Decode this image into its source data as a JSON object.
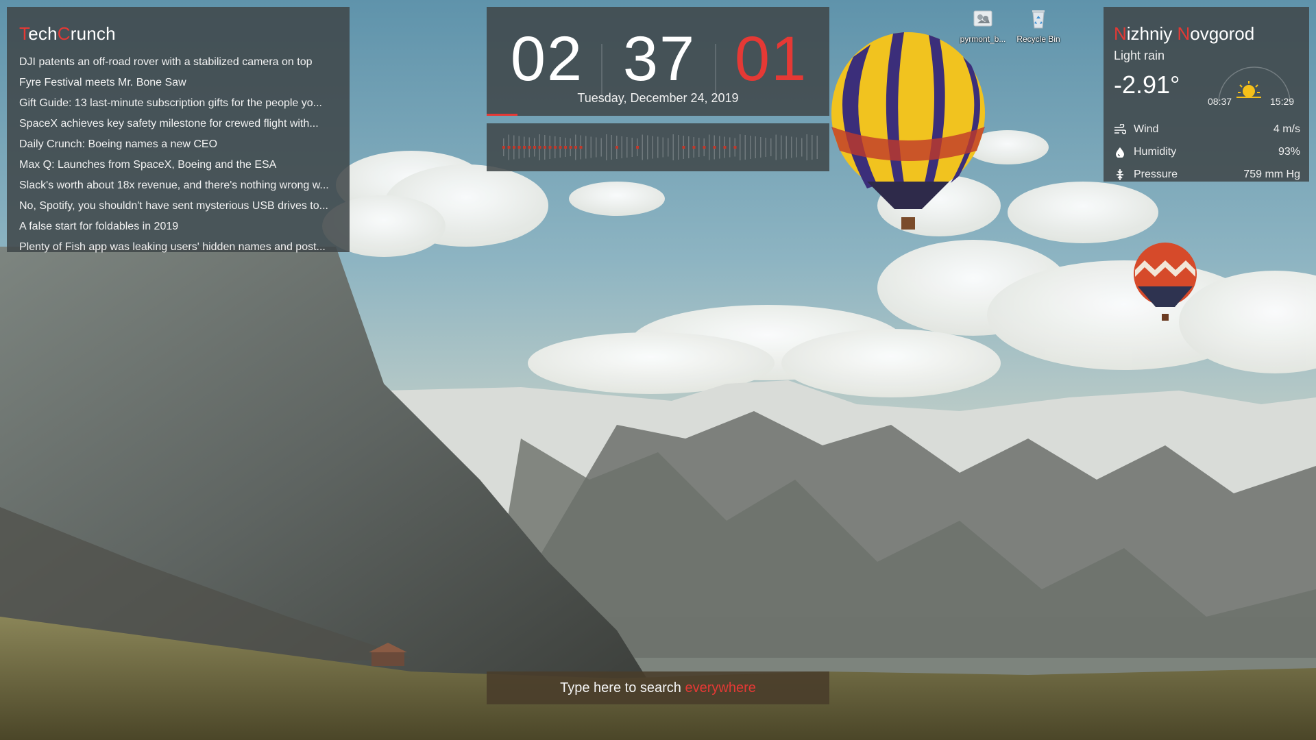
{
  "news": {
    "title_first": "T",
    "title_mid": "ech",
    "title_accent": "C",
    "title_rest": "runch",
    "items": [
      "DJI patents an off-road rover with a stabilized camera on top",
      "Fyre Festival meets Mr. Bone Saw",
      "Gift Guide: 13 last-minute subscription gifts for the people yo...",
      "SpaceX achieves key safety milestone for crewed flight with...",
      "Daily Crunch: Boeing names a new CEO",
      "Max Q: Launches from SpaceX, Boeing and the ESA",
      "Slack's worth about 18x revenue, and there's nothing wrong w...",
      "No, Spotify, you shouldn't have sent mysterious USB drives to...",
      "A false start for foldables in 2019",
      "Plenty of Fish app was leaking users' hidden names and post..."
    ]
  },
  "clock": {
    "hours": "02",
    "minutes": "37",
    "seconds": "01",
    "date": "Tuesday, December 24, 2019",
    "seconds_progress": 0.09
  },
  "weather": {
    "city_n1": "N",
    "city_part1": "izhniy ",
    "city_n2": "N",
    "city_part2": "ovgorod",
    "condition": "Light rain",
    "temperature": "-2.91°",
    "sunrise": "08:37",
    "sunset": "15:29",
    "wind_label": "Wind",
    "wind_value": "4 m/s",
    "humidity_label": "Humidity",
    "humidity_value": "93%",
    "pressure_label": "Pressure",
    "pressure_value": "759 mm Hg"
  },
  "desktop": {
    "icon1_label": "pyrmont_b...",
    "icon2_label": "Recycle Bin"
  },
  "search": {
    "prefix": "Type here to search ",
    "highlight": "everywhere"
  },
  "colors": {
    "accent": "#e53935",
    "panel": "#3f4648"
  }
}
